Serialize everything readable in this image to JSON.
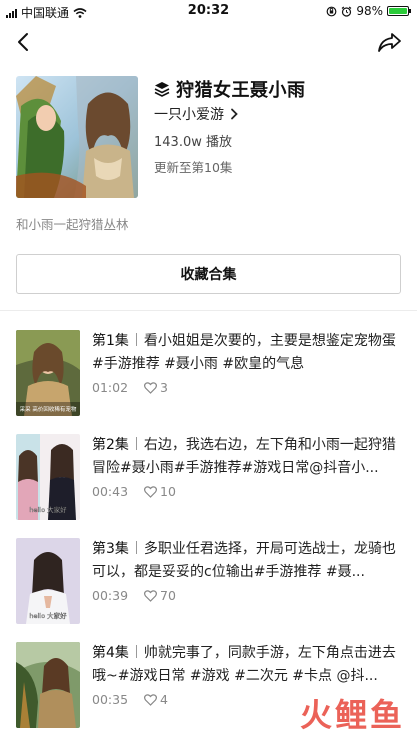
{
  "status_bar": {
    "carrier": "中国联通",
    "time": "20:32",
    "battery_percent": "98%",
    "battery_level": 0.98
  },
  "nav": {
    "back_icon": "chevron-left-icon",
    "share_icon": "share-arrow-icon"
  },
  "album": {
    "title": "狩猎女王聂小雨",
    "author": "一只小爱游",
    "plays": "143.0w 播放",
    "update_status": "更新至第10集",
    "description": "和小雨一起狩猎丛林",
    "collect_label": "收藏合集"
  },
  "episodes": [
    {
      "number": "第1集",
      "text": "看小姐姐是次要的，主要是想鉴定宠物蛋#手游推荐 #聂小雨 #欧皇的气息",
      "duration": "01:02",
      "likes": "3",
      "thumb_caption": "采采 高价回收稀有宠物"
    },
    {
      "number": "第2集",
      "text": "右边，我选右边，左下角和小雨一起狩猎冒险#聂小雨#手游推荐#游戏日常@抖音小...",
      "duration": "00:43",
      "likes": "10",
      "thumb_caption": "hello 大家好"
    },
    {
      "number": "第3集",
      "text": "多职业任君选择，开局可选战士，龙骑也可以，都是妥妥的c位输出#手游推荐 #聂...",
      "duration": "00:39",
      "likes": "70",
      "thumb_caption": "hello 大家好"
    },
    {
      "number": "第4集",
      "text": "帅就完事了，同款手游，左下角点击进去哦~#游戏日常 #游戏 #二次元 #卡点 @抖...",
      "duration": "00:35",
      "likes": "4",
      "thumb_caption": ""
    }
  ],
  "watermark": {
    "text": "火鲤鱼"
  }
}
